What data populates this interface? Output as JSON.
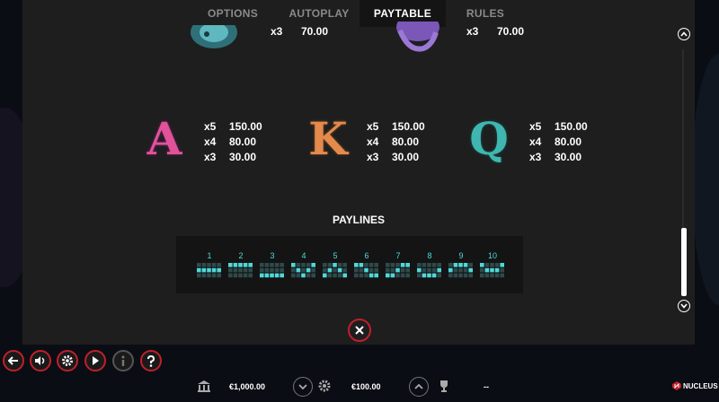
{
  "tabs": [
    {
      "label": "OPTIONS"
    },
    {
      "label": "AUTOPLAY"
    },
    {
      "label": "PAYTABLE"
    },
    {
      "label": "RULES"
    }
  ],
  "active_tab": "PAYTABLE",
  "top_pays": [
    {
      "mult": "x3",
      "amount": "70.00"
    },
    {
      "mult": "x3",
      "amount": "70.00"
    }
  ],
  "symbols": [
    {
      "letter": "A",
      "color": "#e0529a",
      "pays": [
        {
          "mult": "x5",
          "amount": "150.00"
        },
        {
          "mult": "x4",
          "amount": "80.00"
        },
        {
          "mult": "x3",
          "amount": "30.00"
        }
      ]
    },
    {
      "letter": "K",
      "color": "#e38a4c",
      "pays": [
        {
          "mult": "x5",
          "amount": "150.00"
        },
        {
          "mult": "x4",
          "amount": "80.00"
        },
        {
          "mult": "x3",
          "amount": "30.00"
        }
      ]
    },
    {
      "letter": "Q",
      "color": "#3fb7b0",
      "pays": [
        {
          "mult": "x5",
          "amount": "150.00"
        },
        {
          "mult": "x4",
          "amount": "80.00"
        },
        {
          "mult": "x3",
          "amount": "30.00"
        }
      ]
    }
  ],
  "paylines": {
    "title": "PAYLINES",
    "accent": "#4fd8d8",
    "lines": [
      {
        "num": "1",
        "rows": [
          1,
          1,
          1,
          1,
          1
        ]
      },
      {
        "num": "2",
        "rows": [
          0,
          0,
          0,
          0,
          0
        ]
      },
      {
        "num": "3",
        "rows": [
          2,
          2,
          2,
          2,
          2
        ]
      },
      {
        "num": "4",
        "rows": [
          0,
          1,
          2,
          1,
          0
        ]
      },
      {
        "num": "5",
        "rows": [
          2,
          1,
          0,
          1,
          2
        ]
      },
      {
        "num": "6",
        "rows": [
          0,
          0,
          1,
          2,
          2
        ]
      },
      {
        "num": "7",
        "rows": [
          2,
          2,
          1,
          0,
          0
        ]
      },
      {
        "num": "8",
        "rows": [
          1,
          2,
          2,
          2,
          1
        ]
      },
      {
        "num": "9",
        "rows": [
          1,
          0,
          0,
          0,
          1
        ]
      },
      {
        "num": "10",
        "rows": [
          0,
          1,
          1,
          1,
          0
        ]
      }
    ]
  },
  "controls": [
    {
      "name": "back-icon"
    },
    {
      "name": "sound-icon"
    },
    {
      "name": "settings-icon"
    },
    {
      "name": "play-icon"
    },
    {
      "name": "info-icon"
    },
    {
      "name": "help-icon"
    }
  ],
  "status": {
    "balance": "€1,000.00",
    "bet": "€100.00",
    "win": "--",
    "brand": "NUCLEUS"
  },
  "colors": {
    "accent_red": "#c0202a",
    "panel": "#1e1e1f"
  }
}
